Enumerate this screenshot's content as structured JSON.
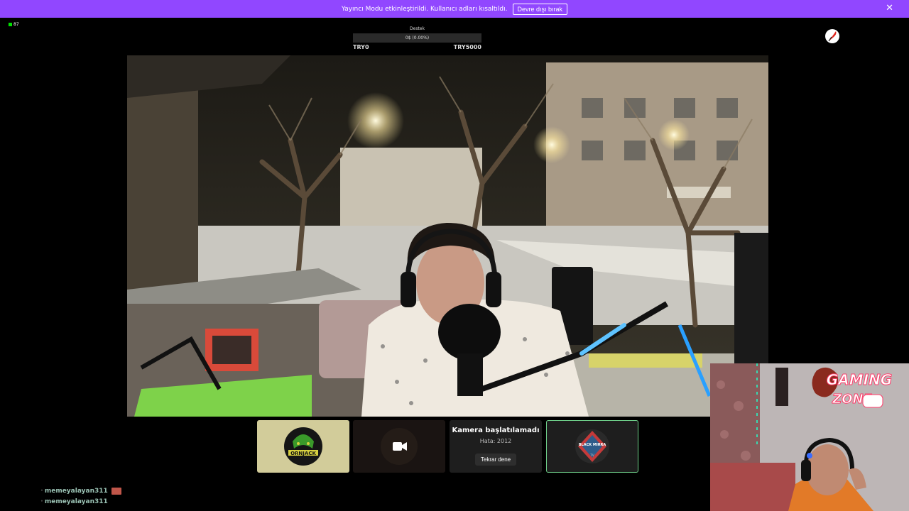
{
  "banner": {
    "message": "Yayıncı Modu etkinleştirildi. Kullanıcı adları kısaltıldı.",
    "disable_label": "Devre dışı bırak",
    "close_icon": "✕",
    "background_color": "#9147ff"
  },
  "viewers": {
    "count": "87",
    "icon": "live-dot-icon"
  },
  "goal": {
    "title": "Destek",
    "progress_text": "0$ (0.00%)",
    "progress": 0,
    "min_label": "TRY0",
    "max_label": "TRY5000"
  },
  "brand_logo": "red-feather-logo",
  "tiles": {
    "tile1_name": "ORNJACK",
    "tile2_icon": "video-camera-icon",
    "tile3_title": "Kamera başlatılamadı",
    "tile3_error": "Hata: 2012",
    "tile3_retry_label": "Tekrar dene",
    "tile4_name": "BLACK MIRRA",
    "tile4_sub": "TV"
  },
  "chat": [
    {
      "user": "memeyalayan311",
      "emote": true
    },
    {
      "user": "memeyalayan311",
      "emote": false
    }
  ],
  "facecam": {
    "sign_line1": "GAMING",
    "sign_line2": "ZONE"
  }
}
